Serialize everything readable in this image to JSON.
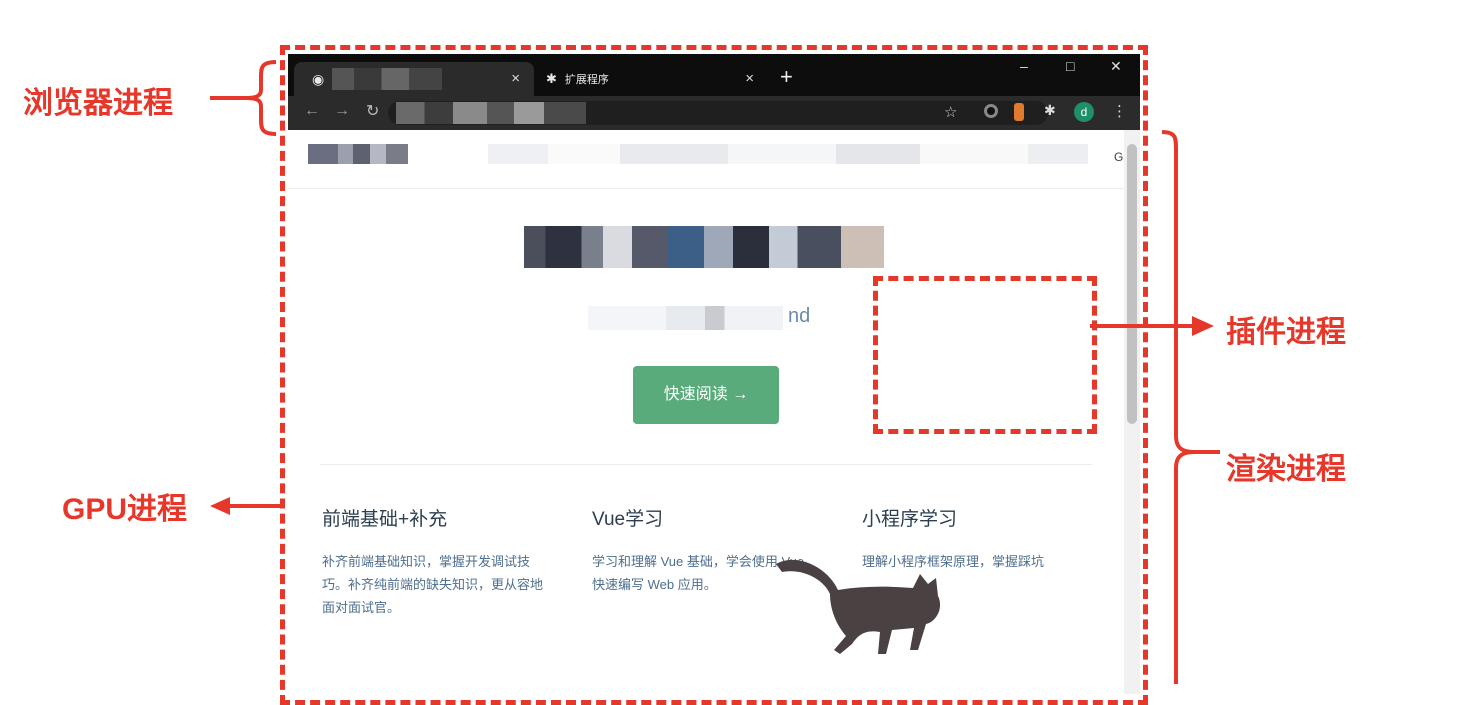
{
  "labels": {
    "browser_process": "浏览器进程",
    "gpu_process": "GPU进程",
    "plugin_process": "插件进程",
    "render_process": "渲染进程"
  },
  "browser": {
    "tabs": [
      {
        "title": "",
        "icon": "globe-icon"
      },
      {
        "title": "扩展程序",
        "icon": "puzzle-icon"
      }
    ],
    "new_tab": "+",
    "close_glyph": "×",
    "avatar_letter": "d"
  },
  "page": {
    "nav_right": "G",
    "subtitle_fragment": "nd",
    "cta_button": "快速阅读 →",
    "features": [
      {
        "title": "前端基础+补充",
        "desc": "补齐前端基础知识，掌握开发调试技巧。补齐纯前端的缺失知识，更从容地面对面试官。"
      },
      {
        "title": "Vue学习",
        "desc": "学习和理解 Vue 基础，学会使用 Vue 快速编写 Web 应用。"
      },
      {
        "title": "小程序学习",
        "desc": "理解小程序框架原理，掌握踩坑"
      }
    ]
  },
  "colors": {
    "annotation_red": "#e5382b",
    "button_green": "#5aab7c",
    "title_text": "#2c3e50"
  }
}
